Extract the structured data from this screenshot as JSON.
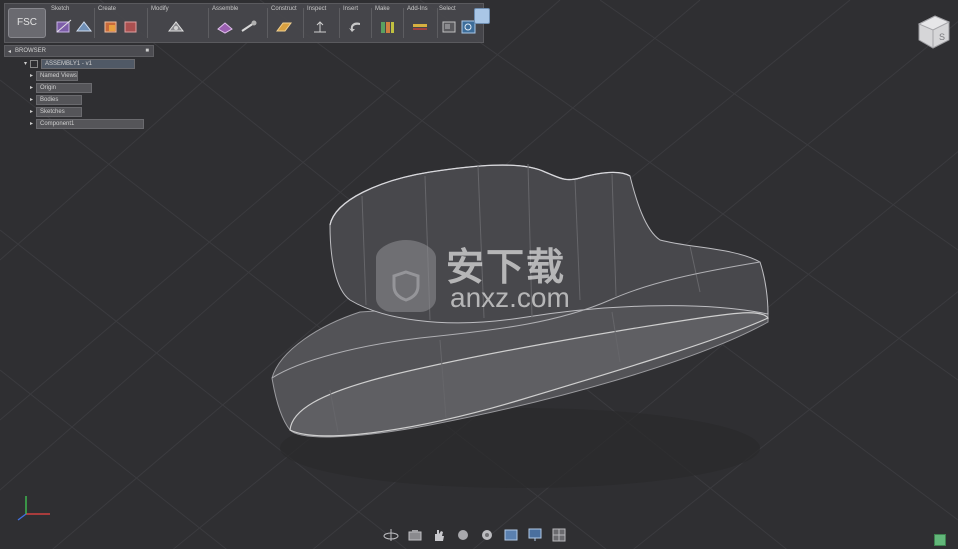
{
  "app": {
    "app_button_label": "FSC"
  },
  "toolbar": {
    "groups": [
      {
        "label": "Sketch",
        "icon": "sketch-icon"
      },
      {
        "label": "Create",
        "icon": "create-icon"
      },
      {
        "label": "Modify",
        "icon": "modify-icon"
      },
      {
        "label": "Assemble",
        "icon": "assemble-icon"
      },
      {
        "label": "Construct",
        "icon": "construct-icon"
      },
      {
        "label": "Inspect",
        "icon": "inspect-icon"
      },
      {
        "label": "Insert",
        "icon": "insert-icon"
      },
      {
        "label": "Make",
        "icon": "make-icon"
      },
      {
        "label": "Add-Ins",
        "icon": "addins-icon"
      },
      {
        "label": "Select",
        "icon": "select-icon"
      }
    ]
  },
  "browser": {
    "title": "BROWSER",
    "root": "ASSEMBLY1 - v1",
    "items": [
      "Named Views",
      "Origin",
      "Bodies",
      "Sketches",
      "Component1"
    ]
  },
  "viewcube": {
    "face_label": "S"
  },
  "nav_bar": {
    "icons": [
      "orbit-icon",
      "look-at-icon",
      "pan-icon",
      "zoom-icon",
      "fit-icon",
      "display-settings-icon",
      "grid-settings-icon",
      "viewports-icon"
    ]
  },
  "watermark": {
    "chinese": "安下载",
    "latin": "anxz.com",
    "icon": "shield-bag-icon"
  },
  "colors": {
    "viewport_bg": "#2f2f32",
    "model_face": "#5a5a5e",
    "edge_highlight": "#c9c9c9"
  }
}
